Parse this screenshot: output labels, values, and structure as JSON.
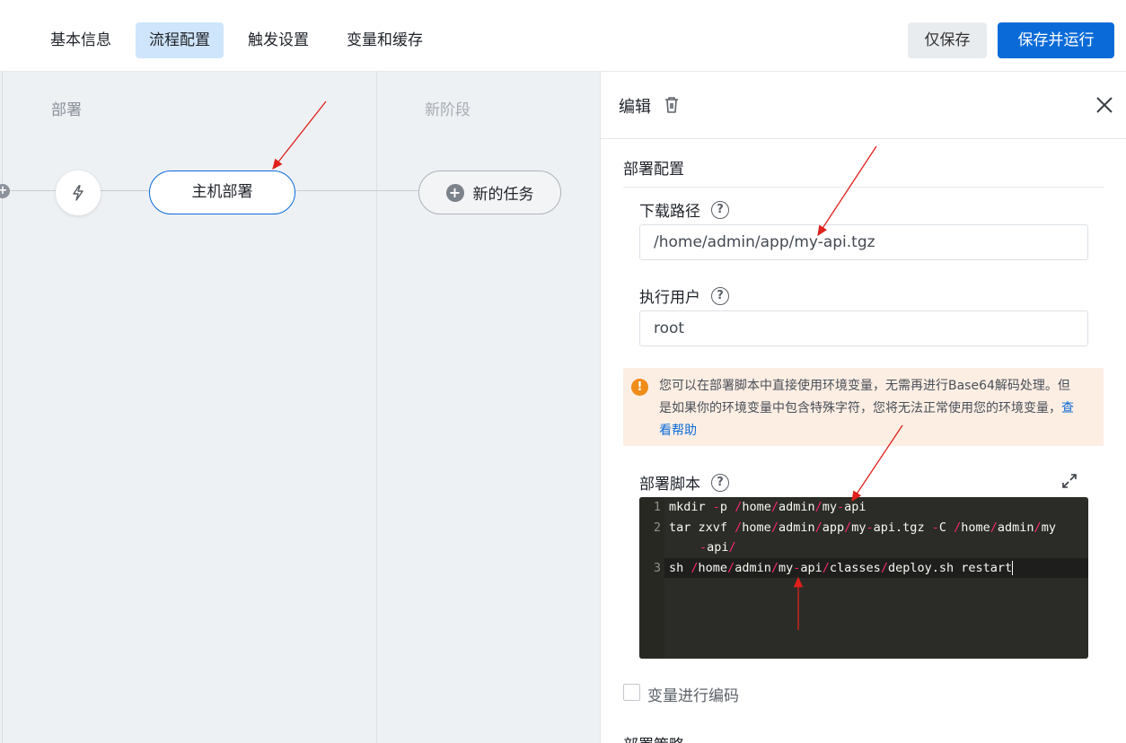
{
  "tabs": [
    {
      "label": "基本信息",
      "active": false
    },
    {
      "label": "流程配置",
      "active": true
    },
    {
      "label": "触发设置",
      "active": false
    },
    {
      "label": "变量和缓存",
      "active": false
    }
  ],
  "actions": {
    "save_only": "仅保存",
    "save_and_run": "保存并运行"
  },
  "pipeline": {
    "stages": [
      {
        "title": "部署",
        "jobs": [
          "主机部署"
        ]
      },
      {
        "title": "新阶段",
        "new_task_label": "新的任务"
      }
    ]
  },
  "panel": {
    "title": "编辑",
    "section_title": "部署配置",
    "download_path": {
      "label": "下载路径",
      "value": "/home/admin/app/my-api.tgz"
    },
    "exec_user": {
      "label": "执行用户",
      "value": "root"
    },
    "notice": {
      "text": "您可以在部署脚本中直接使用环境变量，无需再进行Base64解码处理。但是如果你的环境变量中包含特殊字符，您将无法正常使用您的环境变量，",
      "link": "查看帮助"
    },
    "script": {
      "label": "部署脚本",
      "lines": [
        "mkdir -p /home/admin/my-api",
        "tar zxvf /home/admin/app/my-api.tgz -C /home/admin/my-api/",
        "sh /home/admin/my-api/classes/deploy.sh restart"
      ]
    },
    "encode_vars_label": "变量进行编码",
    "next_section_partial": "部署策略"
  },
  "colors": {
    "primary": "#0a6bd8",
    "tab_active_bg": "#cfe5fb",
    "warning": "#f08c1a",
    "annotation_arrow": "#e0201b"
  }
}
